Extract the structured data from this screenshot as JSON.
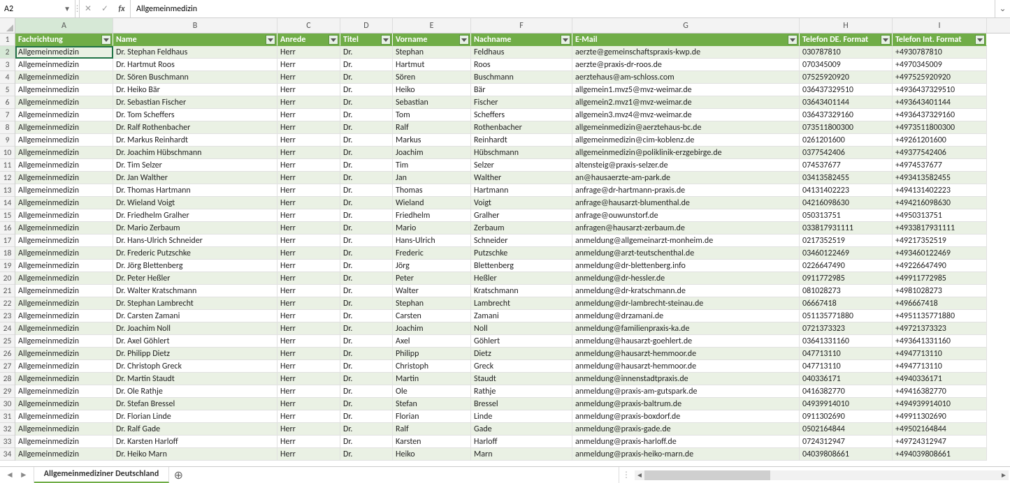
{
  "nameBox": "A2",
  "formula": "Allgemeinmedizin",
  "activeCell": {
    "row": 2,
    "col": 0
  },
  "sheetName": "Allgemeinmediziner Deutschland",
  "columns": [
    "A",
    "B",
    "C",
    "D",
    "E",
    "F",
    "G",
    "H",
    "I"
  ],
  "colClasses": [
    "cA",
    "cB",
    "cC",
    "cD",
    "cE",
    "cF",
    "cG",
    "cH",
    "cI"
  ],
  "headers": [
    "Fachrichtung",
    "Name",
    "Anrede",
    "Titel",
    "Vorname",
    "Nachname",
    "E-Mail",
    "Telefon DE. Format",
    "Telefon Int. Format"
  ],
  "rows": [
    [
      "Allgemeinmedizin",
      "Dr. Stephan Feldhaus",
      "Herr",
      "Dr.",
      "Stephan",
      "Feldhaus",
      "aerzte@gemeinschaftspraxis-kwp.de",
      "030787810",
      "+4930787810"
    ],
    [
      "Allgemeinmedizin",
      "Dr. Hartmut Roos",
      "Herr",
      "Dr.",
      "Hartmut",
      "Roos",
      "aerzte@praxis-dr-roos.de",
      "070345009",
      "+4970345009"
    ],
    [
      "Allgemeinmedizin",
      "Dr. Sören Buschmann",
      "Herr",
      "Dr.",
      "Sören",
      "Buschmann",
      "aerztehaus@am-schloss.com",
      "07525920920",
      "+497525920920"
    ],
    [
      "Allgemeinmedizin",
      "Dr. Heiko Bär",
      "Herr",
      "Dr.",
      "Heiko",
      "Bär",
      "allgemein1.mvz5@mvz-weimar.de",
      "036437329510",
      "+4936437329510"
    ],
    [
      "Allgemeinmedizin",
      "Dr. Sebastian Fischer",
      "Herr",
      "Dr.",
      "Sebastian",
      "Fischer",
      "allgemein2.mvz1@mvz-weimar.de",
      "03643401144",
      "+493643401144"
    ],
    [
      "Allgemeinmedizin",
      "Dr. Tom Scheffers",
      "Herr",
      "Dr.",
      "Tom",
      "Scheffers",
      "allgemein3.mvz4@mvz-weimar.de",
      "036437329160",
      "+4936437329160"
    ],
    [
      "Allgemeinmedizin",
      "Dr. Ralf Rothenbacher",
      "Herr",
      "Dr.",
      "Ralf",
      "Rothenbacher",
      "allgemeinmedizin@aerztehaus-bc.de",
      "073511800300",
      "+4973511800300"
    ],
    [
      "Allgemeinmedizin",
      "Dr. Markus Reinhardt",
      "Herr",
      "Dr.",
      "Markus",
      "Reinhardt",
      "allgemeinmedizin@cim-koblenz.de",
      "0261201600",
      "+49261201600"
    ],
    [
      "Allgemeinmedizin",
      "Dr. Joachim Hübschmann",
      "Herr",
      "Dr.",
      "Joachim",
      "Hübschmann",
      "allgemeinmedizin@poliklinik-erzgebirge.de",
      "0377542406",
      "+49377542406"
    ],
    [
      "Allgemeinmedizin",
      "Dr. Tim Selzer",
      "Herr",
      "Dr.",
      "Tim",
      "Selzer",
      "altensteig@praxis-selzer.de",
      "074537677",
      "+4974537677"
    ],
    [
      "Allgemeinmedizin",
      "Dr. Jan Walther",
      "Herr",
      "Dr.",
      "Jan",
      "Walther",
      "an@hausaerzte-am-park.de",
      "03413582455",
      "+493413582455"
    ],
    [
      "Allgemeinmedizin",
      "Dr. Thomas Hartmann",
      "Herr",
      "Dr.",
      "Thomas",
      "Hartmann",
      "anfrage@dr-hartmann-praxis.de",
      "04131402223",
      "+494131402223"
    ],
    [
      "Allgemeinmedizin",
      "Dr. Wieland Voigt",
      "Herr",
      "Dr.",
      "Wieland",
      "Voigt",
      "anfrage@hausarzt-blumenthal.de",
      "04216098630",
      "+494216098630"
    ],
    [
      "Allgemeinmedizin",
      "Dr. Friedhelm Gralher",
      "Herr",
      "Dr.",
      "Friedhelm",
      "Gralher",
      "anfrage@ouwunstorf.de",
      "050313751",
      "+4950313751"
    ],
    [
      "Allgemeinmedizin",
      "Dr. Mario Zerbaum",
      "Herr",
      "Dr.",
      "Mario",
      "Zerbaum",
      "anfragen@hausarzt-zerbaum.de",
      "033817931111",
      "+4933817931111"
    ],
    [
      "Allgemeinmedizin",
      "Dr. Hans-Ulrich Schneider",
      "Herr",
      "Dr.",
      "Hans-Ulrich",
      "Schneider",
      "anmeldung@allgemeinarzt-monheim.de",
      "0217352519",
      "+49217352519"
    ],
    [
      "Allgemeinmedizin",
      "Dr. Frederic Putzschke",
      "Herr",
      "Dr.",
      "Frederic",
      "Putzschke",
      "anmeldung@arzt-teutschenthal.de",
      "03460122469",
      "+493460122469"
    ],
    [
      "Allgemeinmedizin",
      "Dr. Jörg Blettenberg",
      "Herr",
      "Dr.",
      "Jörg",
      "Blettenberg",
      "anmeldung@dr-blettenberg.info",
      "0226647490",
      "+49226647490"
    ],
    [
      "Allgemeinmedizin",
      "Dr. Peter Heßler",
      "Herr",
      "Dr.",
      "Peter",
      "Heßler",
      "anmeldung@dr-hessler.de",
      "0911772985",
      "+49911772985"
    ],
    [
      "Allgemeinmedizin",
      "Dr. Walter Kratschmann",
      "Herr",
      "Dr.",
      "Walter",
      "Kratschmann",
      "anmeldung@dr-kratschmann.de",
      "081028273",
      "+4981028273"
    ],
    [
      "Allgemeinmedizin",
      "Dr. Stephan Lambrecht",
      "Herr",
      "Dr.",
      "Stephan",
      "Lambrecht",
      "anmeldung@dr-lambrecht-steinau.de",
      "06667418",
      "+496667418"
    ],
    [
      "Allgemeinmedizin",
      "Dr. Carsten Zamani",
      "Herr",
      "Dr.",
      "Carsten",
      "Zamani",
      "anmeldung@drzamani.de",
      "051135771880",
      "+4951135771880"
    ],
    [
      "Allgemeinmedizin",
      "Dr. Joachim Noll",
      "Herr",
      "Dr.",
      "Joachim",
      "Noll",
      "anmeldung@familienpraxis-ka.de",
      "0721373323",
      "+49721373323"
    ],
    [
      "Allgemeinmedizin",
      "Dr. Axel Göhlert",
      "Herr",
      "Dr.",
      "Axel",
      "Göhlert",
      "anmeldung@hausarzt-goehlert.de",
      "03641331160",
      "+493641331160"
    ],
    [
      "Allgemeinmedizin",
      "Dr. Philipp Dietz",
      "Herr",
      "Dr.",
      "Philipp",
      "Dietz",
      "anmeldung@hausarzt-hemmoor.de",
      "047713110",
      "+4947713110"
    ],
    [
      "Allgemeinmedizin",
      "Dr. Christoph Greck",
      "Herr",
      "Dr.",
      "Christoph",
      "Greck",
      "anmeldung@hausarzt-hemmoor.de",
      "047713110",
      "+4947713110"
    ],
    [
      "Allgemeinmedizin",
      "Dr. Martin Staudt",
      "Herr",
      "Dr.",
      "Martin",
      "Staudt",
      "anmeldung@innenstadtpraxis.de",
      "040336171",
      "+4940336171"
    ],
    [
      "Allgemeinmedizin",
      "Dr. Ole Rathje",
      "Herr",
      "Dr.",
      "Ole",
      "Rathje",
      "anmeldung@praxis-am-gutspark.de",
      "0416382770",
      "+49416382770"
    ],
    [
      "Allgemeinmedizin",
      "Dr. Stefan Bressel",
      "Herr",
      "Dr.",
      "Stefan",
      "Bressel",
      "anmeldung@praxis-baltrum.de",
      "04939914010",
      "+494939914010"
    ],
    [
      "Allgemeinmedizin",
      "Dr. Florian Linde",
      "Herr",
      "Dr.",
      "Florian",
      "Linde",
      "anmeldung@praxis-boxdorf.de",
      "0911302690",
      "+49911302690"
    ],
    [
      "Allgemeinmedizin",
      "Dr. Ralf Gade",
      "Herr",
      "Dr.",
      "Ralf",
      "Gade",
      "anmeldung@praxis-gade.de",
      "0502164844",
      "+49502164844"
    ],
    [
      "Allgemeinmedizin",
      "Dr. Karsten Harloff",
      "Herr",
      "Dr.",
      "Karsten",
      "Harloff",
      "anmeldung@praxis-harloff.de",
      "0724312947",
      "+49724312947"
    ],
    [
      "Allgemeinmedizin",
      "Dr. Heiko Marn",
      "Herr",
      "Dr.",
      "Heiko",
      "Marn",
      "anmeldung@praxis-heiko-marn.de",
      "04039808661",
      "+494039808661"
    ]
  ]
}
